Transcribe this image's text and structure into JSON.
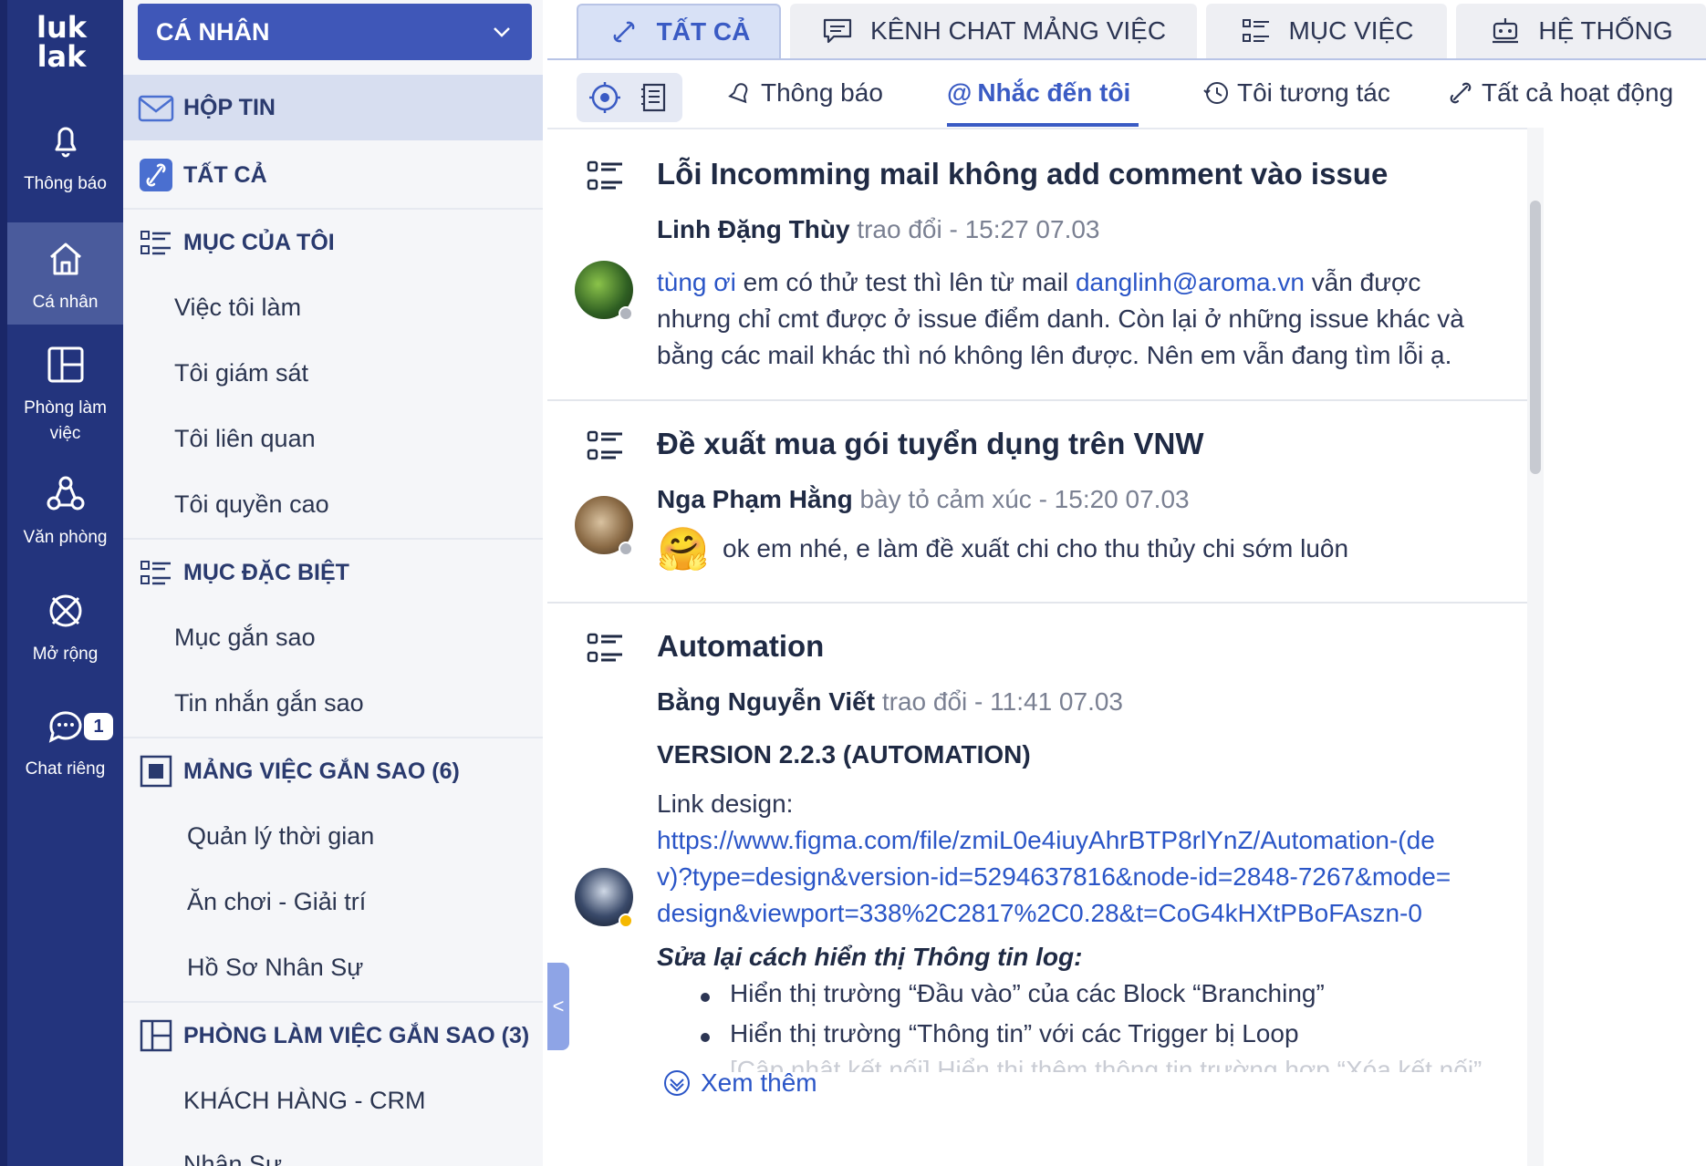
{
  "rail": {
    "logo_line1": "luk",
    "logo_line2": "lak",
    "items": [
      {
        "label": "Thông báo",
        "icon": "bell-icon"
      },
      {
        "label": "Cá nhân",
        "icon": "home-icon"
      },
      {
        "label_line1": "Phòng làm",
        "label_line2": "việc",
        "icon": "layout-icon"
      },
      {
        "label": "Văn phòng",
        "icon": "office-icon"
      },
      {
        "label": "Mở rộng",
        "icon": "extend-icon"
      },
      {
        "label": "Chat riêng",
        "icon": "chat-icon",
        "badge": "1"
      }
    ]
  },
  "panel": {
    "dropdown": "CÁ NHÂN",
    "inbox": "HỘP TIN",
    "all": "TẤT CẢ",
    "my_items": "MỤC CỦA TÔI",
    "my_items_sub": [
      "Việc tôi làm",
      "Tôi giám sát",
      "Tôi liên quan",
      "Tôi quyền cao"
    ],
    "special": "MỤC ĐẶC BIỆT",
    "special_sub": [
      "Mục gắn sao",
      "Tin nhắn gắn sao"
    ],
    "starred_networks": "MẢNG VIỆC GẮN SAO (6)",
    "starred_networks_sub": [
      "Quản lý thời gian",
      "Ăn chơi - Giải trí",
      "Hồ Sơ Nhân Sự"
    ],
    "starred_rooms": "PHÒNG LÀM VIỆC GẮN SAO (3)",
    "starred_rooms_sub": [
      "KHÁCH HÀNG - CRM",
      "Nhân Sự"
    ]
  },
  "tabs": [
    "TẤT CẢ",
    "KÊNH CHAT MẢNG VIỆC",
    "MỤC VIỆC",
    "HỆ THỐNG"
  ],
  "subtabs": [
    "Thông báo",
    "Nhắc đến tôi",
    "Tôi tương tác",
    "Tất cả hoạt động"
  ],
  "feed": [
    {
      "title": "Lỗi Incomming mail không add comment vào issue",
      "author": "Linh Đặng Thùy",
      "action": "trao đổi - 15:27 07.03",
      "mention": "tùng ơi",
      "text1": " em có thử test thì lên từ mail ",
      "email": "danglinh@aroma.vn",
      "text2": " vẫn được",
      "line2": "nhưng chỉ cmt được ở issue điểm danh. Còn lại ở những issue khác và",
      "line3": "bằng các mail khác thì nó không lên được. Nên em vẫn đang tìm lỗi ạ."
    },
    {
      "title": "Đề xuất mua gói tuyển dụng trên VNW",
      "author": "Nga Phạm Hằng",
      "action": "bày tỏ cảm xúc - 15:20 07.03",
      "emoji": "🤗",
      "text": "ok em nhé, e làm đề xuất chi cho thu thủy chi sớm luôn"
    },
    {
      "title": "Automation",
      "author": "Bằng Nguyễn Viết",
      "action": "trao đổi - 11:41 07.03",
      "heading": "VERSION 2.2.3 (AUTOMATION)",
      "link_label": "Link design:",
      "url1": "https://www.figma.com/file/zmiL0e4iuyAhrBTP8rlYnZ/Automation-(de",
      "url2": "v)?type=design&version-id=5294637816&node-id=2848-7267&mode=",
      "url3": "design&viewport=338%2C2817%2C0.28&t=CoG4kHXtPBoFAszn-0",
      "subheading": "Sửa lại cách hiển thị Thông tin log:",
      "bullets": [
        "Hiển thị trường “Đầu vào” của các Block “Branching”",
        "Hiển thị trường “Thông tin” với các Trigger bị Loop"
      ],
      "faded": "[Cập nhật kết nối] Hiển thị thêm thông tin trường hợp “Xóa kết nối”",
      "more": "Xem thêm"
    }
  ],
  "colors": {
    "rail": "#23347d",
    "accent": "#3a5bc4",
    "link": "#2a55c7"
  }
}
